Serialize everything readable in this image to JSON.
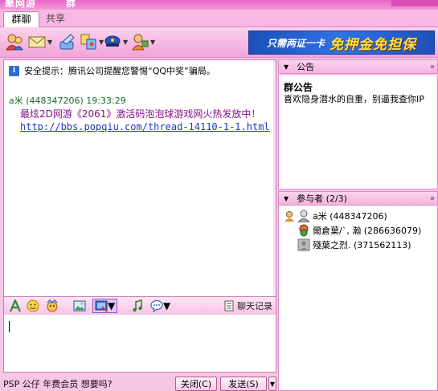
{
  "window": {
    "title": "聚网游",
    "title_suffix": "群"
  },
  "tabs": [
    {
      "label": "群聊",
      "active": true
    },
    {
      "label": "共享",
      "active": false
    }
  ],
  "toolbar": {
    "banner_prefix": "只需两证一卡",
    "banner_main": "免押金免担保"
  },
  "chat": {
    "notice": "安全提示：腾讯公司提醒您警惕“QQ中奖”骗局。",
    "sender": "a米 (448347206) 19:33:29",
    "message": "最炫2D网游《2061》激活码泡泡球游戏网火热发放中！",
    "link": "http://bbs.popqiu.com/thread-14110-1-1.html"
  },
  "input_toolbar": {
    "history_label": "聊天记录"
  },
  "bottom": {
    "ad_text": "PSP 公仔 年费会员 想要吗?",
    "close_label": "关闭(C)",
    "send_label": "发送(S)"
  },
  "announcement": {
    "header": "公告",
    "title": "群公告",
    "text": "喜欢隐身潜水的自重，别逼我查你IP"
  },
  "participants": {
    "header": "参与者 (2/3)",
    "members": [
      {
        "name": "a米 (448347206)",
        "icon": "owner-user-icon"
      },
      {
        "name": "爾倉葉/`, 瀚 (286636079)",
        "icon": "user-icon"
      },
      {
        "name": "殘葉之烈. (371562113)",
        "icon": "offline-user-icon"
      }
    ]
  }
}
